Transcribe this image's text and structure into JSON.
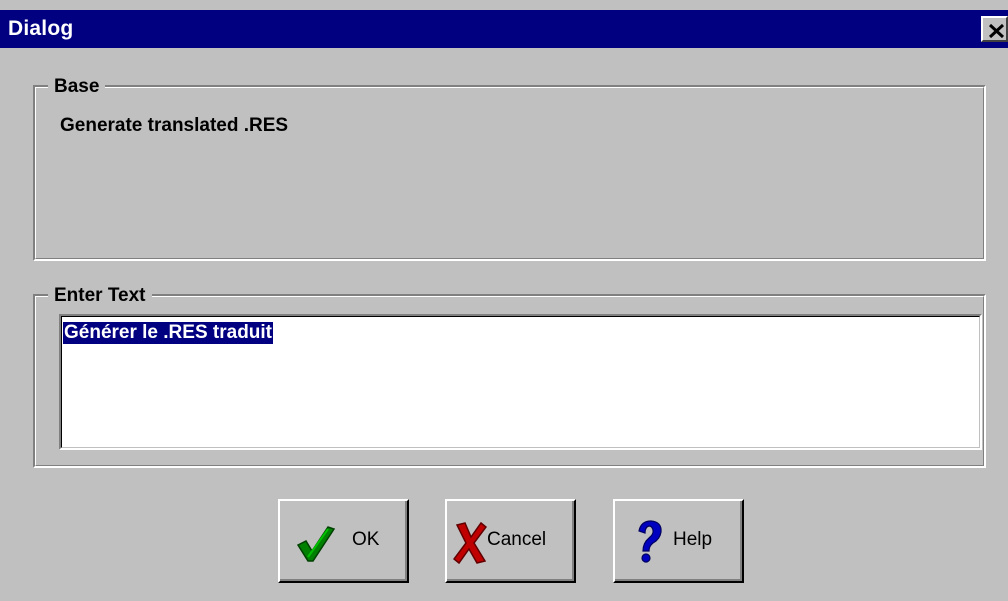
{
  "window": {
    "title": "Dialog",
    "close_icon": "close-icon"
  },
  "base_group": {
    "label": "Base",
    "text": "Generate translated .RES"
  },
  "enter_group": {
    "label": "Enter Text",
    "value": "Générer le .RES traduit"
  },
  "buttons": {
    "ok": {
      "label": "OK",
      "icon": "checkmark-icon"
    },
    "cancel": {
      "label": "Cancel",
      "icon": "x-icon"
    },
    "help": {
      "label": "Help",
      "icon": "question-mark-icon"
    }
  },
  "colors": {
    "face": "#c0c0c0",
    "titlebar": "#000080",
    "selection": "#000080",
    "ok_icon": "#008000",
    "cancel_icon": "#c00000",
    "help_icon": "#0000c0"
  }
}
